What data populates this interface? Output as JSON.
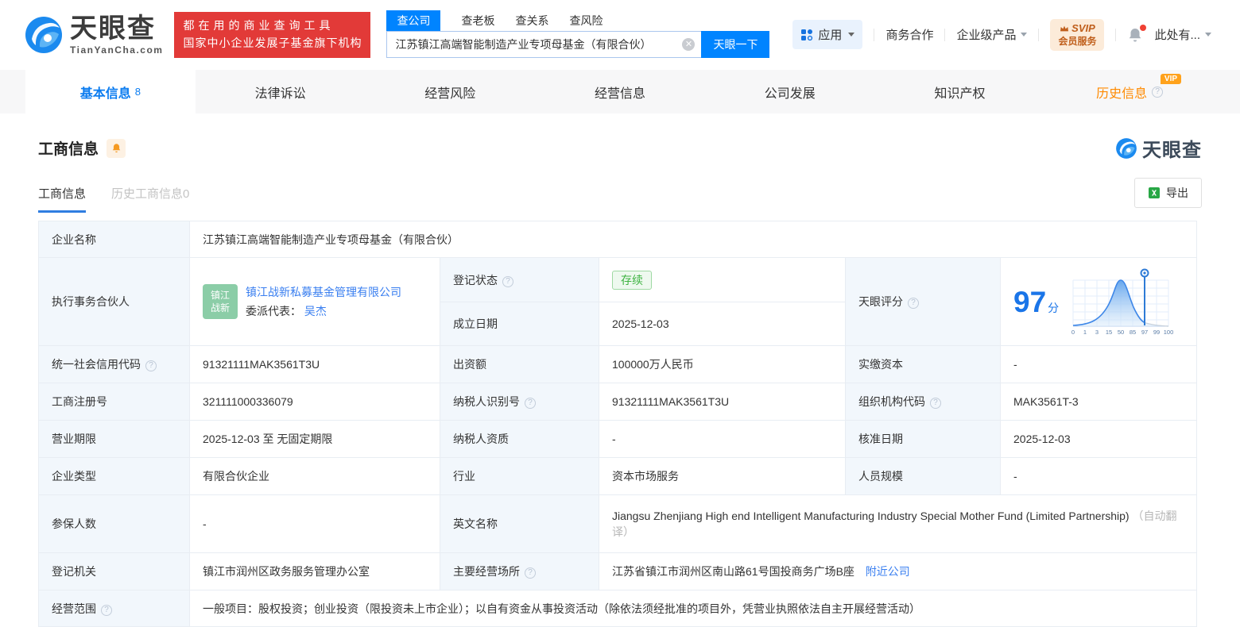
{
  "icons": {
    "help": "?",
    "clear": "✕"
  },
  "brand": {
    "logo_text": "天眼查",
    "logo_sub": "TianYanCha.com",
    "slogan_line1": "都在用的商业查询工具",
    "slogan_line2": "国家中小企业发展子基金旗下机构"
  },
  "search": {
    "tabs": [
      {
        "label": "查公司"
      },
      {
        "label": "查老板"
      },
      {
        "label": "查关系"
      },
      {
        "label": "查风险"
      }
    ],
    "value": "江苏镇江高端智能制造产业专项母基金（有限合伙）",
    "button": "天眼一下"
  },
  "header_nav": {
    "apps": "应用",
    "cooperation": "商务合作",
    "enterprise": "企业级产品",
    "svip_line1": "SVIP",
    "svip_line2": "会员服务",
    "user": "此处有..."
  },
  "nav_tabs": [
    {
      "label": "基本信息",
      "count": "8"
    },
    {
      "label": "法律诉讼"
    },
    {
      "label": "经营风险"
    },
    {
      "label": "经营信息"
    },
    {
      "label": "公司发展"
    },
    {
      "label": "知识产权"
    },
    {
      "label": "历史信息",
      "vip_badge": "VIP"
    }
  ],
  "section": {
    "title": "工商信息",
    "subtab_active": "工商信息",
    "subtab_history": "历史工商信息0",
    "export": "导出",
    "watermark": "天眼查"
  },
  "company": {
    "name_label": "企业名称",
    "name": "江苏镇江高端智能制造产业专项母基金（有限合伙）",
    "partner_label": "执行事务合伙人",
    "partner_avatar_line1": "镇江",
    "partner_avatar_line2": "战新",
    "partner_name": "镇江战新私募基金管理有限公司",
    "delegate_label": "委派代表：",
    "delegate_name": "吴杰",
    "reg_status_label": "登记状态",
    "reg_status": "存续",
    "establish_label": "成立日期",
    "establish_date": "2025-12-03",
    "score_label": "天眼评分",
    "score": "97",
    "score_unit": "分"
  },
  "score_chart": {
    "type": "area",
    "ticks": [
      "0",
      "1",
      "3",
      "15",
      "50",
      "85",
      "97",
      "99",
      "100"
    ],
    "marker_value": "97"
  },
  "table": {
    "row3": {
      "l1": "统一社会信用代码",
      "v1": "91321111MAK3561T3U",
      "l2": "出资额",
      "v2": "100000万人民币",
      "l3": "实缴资本",
      "v3": "-"
    },
    "row4": {
      "l1": "工商注册号",
      "v1": "321111000336079",
      "l2": "纳税人识别号",
      "v2": "91321111MAK3561T3U",
      "l3": "组织机构代码",
      "v3": "MAK3561T-3"
    },
    "row5": {
      "l1": "营业期限",
      "v1": "2025-12-03 至 无固定期限",
      "l2": "纳税人资质",
      "v2": "-",
      "l3": "核准日期",
      "v3": "2025-12-03"
    },
    "row6": {
      "l1": "企业类型",
      "v1": "有限合伙企业",
      "l2": "行业",
      "v2": "资本市场服务",
      "l3": "人员规模",
      "v3": "-"
    },
    "row7": {
      "l1": "参保人数",
      "v1": "-",
      "l2": "英文名称",
      "v2": "Jiangsu Zhenjiang High end Intelligent Manufacturing Industry Special Mother Fund (Limited Partnership)",
      "v2_note": "（自动翻译）"
    },
    "row8": {
      "l1": "登记机关",
      "v1": "镇江市润州区政务服务管理办公室",
      "l2": "主要经营场所",
      "v2": "江苏省镇江市润州区南山路61号国投商务广场B座",
      "v2_link": "附近公司"
    },
    "row9": {
      "l1": "经营范围",
      "v1": "一般项目：股权投资；创业投资（限投资未上市企业）；以自有资金从事投资活动（除依法须经批准的项目外，凭营业执照依法自主开展经营活动）"
    }
  }
}
